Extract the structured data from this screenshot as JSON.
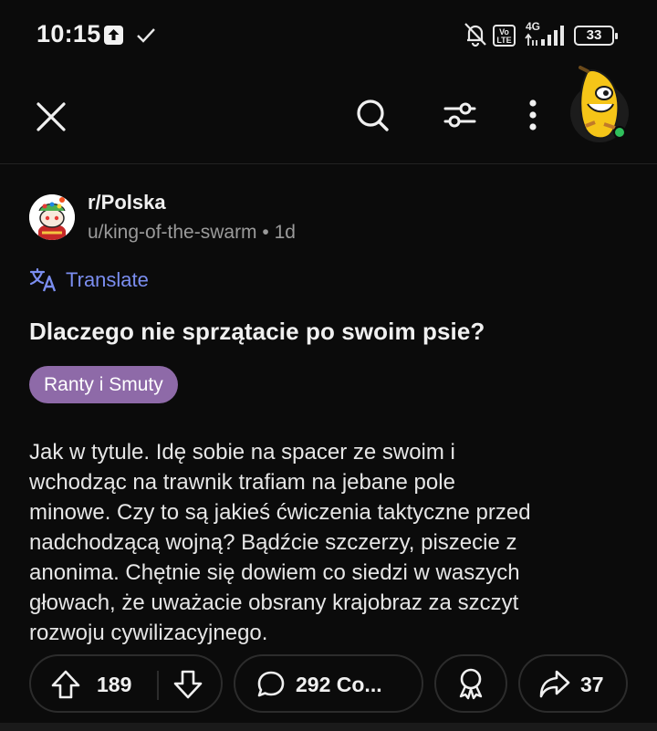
{
  "status_bar": {
    "time": "10:15",
    "battery": "33",
    "network": "4G",
    "volte": "Vo\nLTE"
  },
  "toolbar": {
    "icons": [
      "close-icon",
      "search-icon",
      "filter-icon",
      "more-vertical-icon",
      "user-avatar"
    ],
    "online_color": "#2fbf5b"
  },
  "post": {
    "subreddit": "r/Polska",
    "author_line": "u/king-of-the-swarm • 1d",
    "translate_label": "Translate",
    "title": "Dlaczego nie sprzątacie po swoim psie?",
    "flair": "Ranty i Smuty",
    "flair_color": "#8e6aa8",
    "body": "Jak w tytule. Idę sobie na spacer ze swoim i\nwchodząc na trawnik trafiam na jebane pole\nminowe. Czy to są jakieś ćwiczenia taktyczne przed\nnadchodzącą wojną? Bądźcie szczerzy, piszecie z\nanonima. Chętnie się dowiem co siedzi w waszych\ngłowach, że uważacie obsrany krajobraz za szczyt\nrozwoju cywilizacyjnego."
  },
  "actions": {
    "votes": "189",
    "comments": "292 Co...",
    "shares": "37"
  },
  "colors": {
    "background": "#0b0b0b",
    "link": "#7b8ef0"
  }
}
